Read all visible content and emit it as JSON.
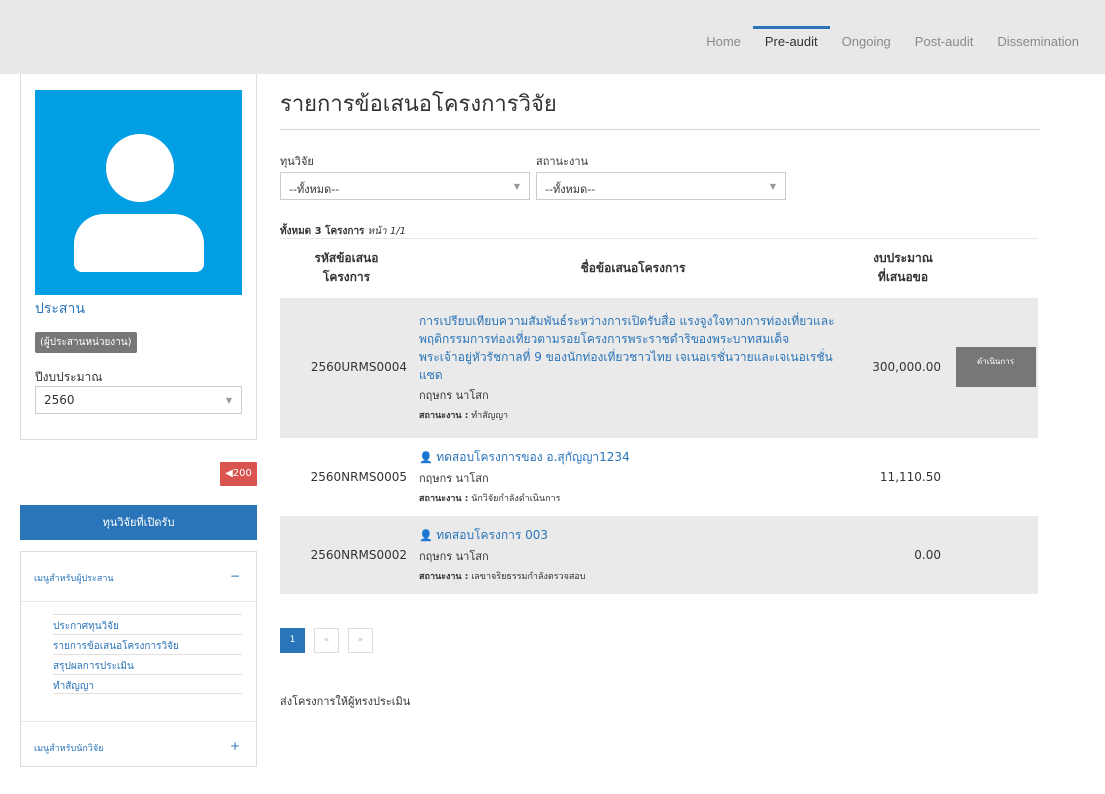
{
  "nav": {
    "items": [
      "Home",
      "Pre-audit",
      "Ongoing",
      "Post-audit",
      "Dissemination"
    ],
    "active_index": 1
  },
  "profile": {
    "name": "ประสาน",
    "role": "(ผู้ประสานหน่วยงาน)",
    "fiscal_year_label": "ปีงบประมาณ",
    "fiscal_year_value": "2560"
  },
  "badge": {
    "icon": "megaphone-icon",
    "count": "200"
  },
  "open_funds_button": "ทุนวิจัยที่เปิดรับ",
  "menus": {
    "coordinator": {
      "label": "เมนูสำหรับผู้ประสาน",
      "toggle": "−",
      "items": [
        "ประกาศทุนวิจัย",
        "รายการข้อเสนอโครงการวิจัย",
        "สรุปผลการประเมิน",
        "ทำสัญญา"
      ]
    },
    "researcher": {
      "label": "เมนูสำหรับนักวิจัย",
      "toggle": "+"
    }
  },
  "main": {
    "title": "รายการข้อเสนอโครงการวิจัย",
    "filter_fund": {
      "label": "ทุนวิจัย",
      "value": "--ทั้งหมด--"
    },
    "filter_status": {
      "label": "สถานะงาน",
      "value": "--ทั้งหมด--"
    },
    "count_prefix": "ทั้งหมด 3 โครงการ",
    "count_page": "หน้า 1/1",
    "table": {
      "headers": [
        "รหัสข้อเสนอ\nโครงการ",
        "ชื่อข้อเสนอโครงการ",
        "งบประมาณ\nที่เสนอขอ",
        ""
      ],
      "status_label": "สถานะงาน :",
      "rows": [
        {
          "code": "2560URMS0004",
          "title": "การเปรียบเทียบความสัมพันธ์ระหว่างการเปิดรับสื่อ แรงจูงใจทางการท่องเที่ยวและพฤติกรรมการท่องเที่ยวตามรอยโครงการพระราชดำริของพระบาทสมเด็จพระเจ้าอยู่หัวรัชกาลที่ 9 ของนักท่องเที่ยวชาวไทย เจเนอเรชั่นวายและเจเนอเรชั่นแซด",
          "owner": "กฤษกร นาโสก",
          "status": "ทำสัญญา",
          "budget": "300,000.00",
          "action": "ดำเนินการ"
        },
        {
          "code": "2560NRMS0005",
          "title": "ทดสอบโครงการของ อ.สุกัญญา1234",
          "owner": "กฤษกร นาโสก",
          "status": "นักวิจัยกำลังดำเนินการ",
          "budget": "11,110.50"
        },
        {
          "code": "2560NRMS0002",
          "title": "ทดสอบโครงการ 003",
          "owner": "กฤษกร นาโสก",
          "status": "เลขาจริยธรรมกำลังตรวจสอบ",
          "budget": "0.00"
        }
      ]
    },
    "pager": {
      "current": "1",
      "prev": "«",
      "next": "»"
    },
    "send_text": "ส่งโครงการให้ผู้ทรงประเมิน"
  }
}
